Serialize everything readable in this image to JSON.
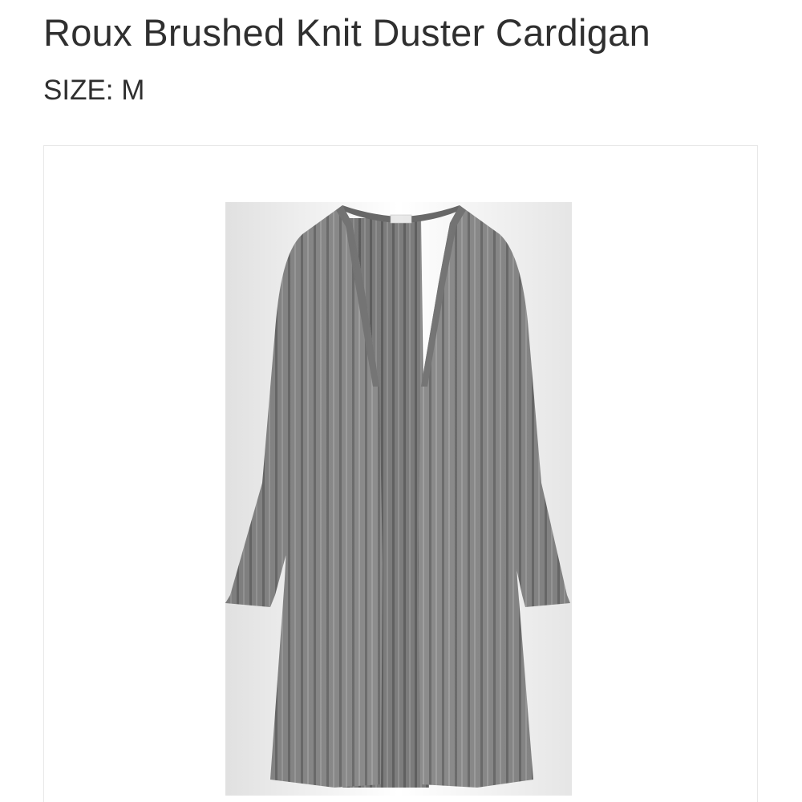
{
  "product": {
    "name": "Roux Brushed Knit Duster Cardigan",
    "size_label": "SIZE:",
    "size_value": "M"
  },
  "image": {
    "icon": "cardigan-photo",
    "garment_color": "#8c8c8c",
    "rib_color": "#6b6b6b",
    "background": "#ffffff"
  }
}
